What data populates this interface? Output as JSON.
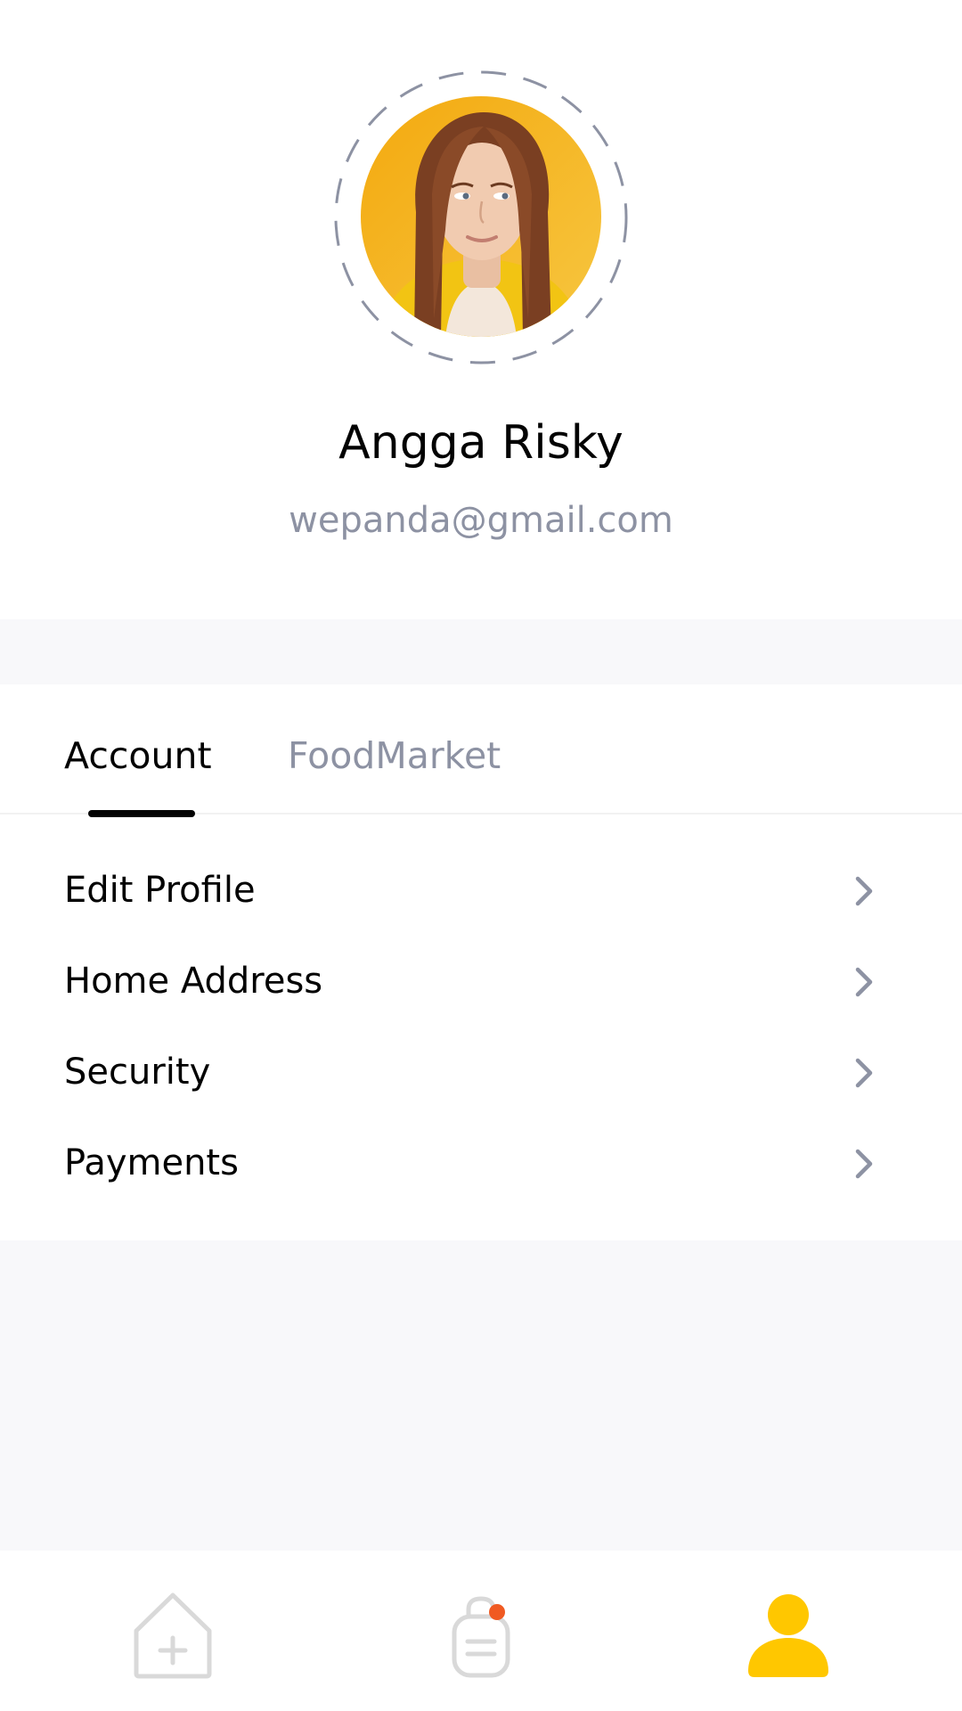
{
  "profile": {
    "name": "Angga Risky",
    "email": "wepanda@gmail.com"
  },
  "tabs": [
    {
      "label": "Account",
      "active": true
    },
    {
      "label": "FoodMarket",
      "active": false
    }
  ],
  "menu": {
    "items": [
      {
        "label": "Edit Profile",
        "icon": "chevron-right-icon"
      },
      {
        "label": "Home Address",
        "icon": "chevron-right-icon"
      },
      {
        "label": "Security",
        "icon": "chevron-right-icon"
      },
      {
        "label": "Payments",
        "icon": "chevron-right-icon"
      }
    ]
  },
  "bottom_nav": {
    "items": [
      {
        "icon": "home-icon",
        "active": false
      },
      {
        "icon": "shopping-bag-icon",
        "active": false,
        "badge": true
      },
      {
        "icon": "profile-icon",
        "active": true
      }
    ]
  },
  "colors": {
    "accent": "#FFC700",
    "text_primary": "#020202",
    "text_secondary": "#8D92A3",
    "background": "#F8F8FA",
    "badge": "#F05A22",
    "inactive_icon": "#D9D9D9"
  }
}
